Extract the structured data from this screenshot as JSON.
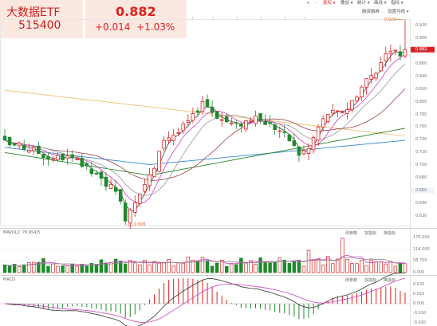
{
  "header": {
    "fund_name": "大数据ETF",
    "fund_code": "515400",
    "price": "0.882",
    "change": "+0.014",
    "change_pct": "+1.03%"
  },
  "toolbar": {
    "items": [
      "+",
      "-",
      "复权",
      "叠加",
      "统计",
      "画线",
      "指标"
    ],
    "active_index": 2,
    "sub_items": [
      "融资融券",
      "设置均线"
    ]
  },
  "main_chart": {
    "price_axis": [
      "0.920",
      "0.900",
      "0.880",
      "0.860",
      "0.840",
      "0.820",
      "0.800",
      "0.780",
      "0.760",
      "0.740",
      "0.720",
      "0.700",
      "0.680",
      "0.660",
      "0.640",
      "0.620"
    ],
    "current_price_tag": "0.882",
    "high_label": "0.929",
    "low_label": "0.606",
    "colors": {
      "up": "#e02020",
      "down": "#1f8a2c",
      "ma5": "#444444",
      "ma10": "#f0a030",
      "ma20": "#d040c0",
      "ma60": "#2a8a2a",
      "ma120": "#3a8ad0",
      "ma250": "#f2c070"
    }
  },
  "volume_panel": {
    "label": "MAVOL2: 76.654万",
    "buttons": [
      "改参数",
      "加指标",
      "换指标"
    ],
    "axis": [
      "176.000",
      "116.000",
      "58.700",
      "0.000"
    ]
  },
  "macd_panel": {
    "label": "MACD",
    "buttons": [
      "改参数",
      "加指标",
      "换指标"
    ],
    "axis": [
      "0.020",
      "0.010",
      "0.000",
      "-0.010",
      "-0.020"
    ]
  }
}
